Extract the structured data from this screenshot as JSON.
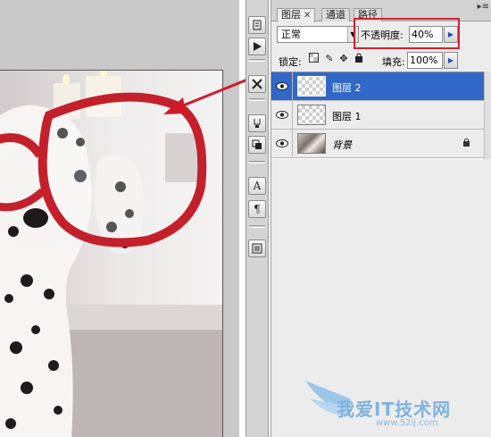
{
  "tabs": [
    {
      "label": "图层",
      "active": true
    },
    {
      "label": "通道",
      "active": false
    },
    {
      "label": "路径",
      "active": false
    }
  ],
  "blend_mode": "正常",
  "opacity": {
    "label": "不透明度:",
    "value": "40%"
  },
  "lock": {
    "label": "锁定:"
  },
  "fill": {
    "label": "填充:",
    "value": "100%"
  },
  "layers": [
    {
      "name": "图层 2",
      "selected": true,
      "visible": true,
      "locked": false
    },
    {
      "name": "图层 1",
      "selected": false,
      "visible": true,
      "locked": false
    },
    {
      "name": "背景",
      "selected": false,
      "visible": true,
      "locked": true
    }
  ],
  "watermark": {
    "text": "我爱IT技术网",
    "url": "www.52ij.com"
  },
  "tools": [
    "history-icon",
    "actions-icon",
    "tools-icon",
    "brushes-icon",
    "clone-icon",
    "character-icon",
    "paragraph-icon",
    "notes-icon"
  ],
  "colors": {
    "highlight": "#d1212f",
    "selection": "#3168c8",
    "glasses": "#c4202c"
  }
}
